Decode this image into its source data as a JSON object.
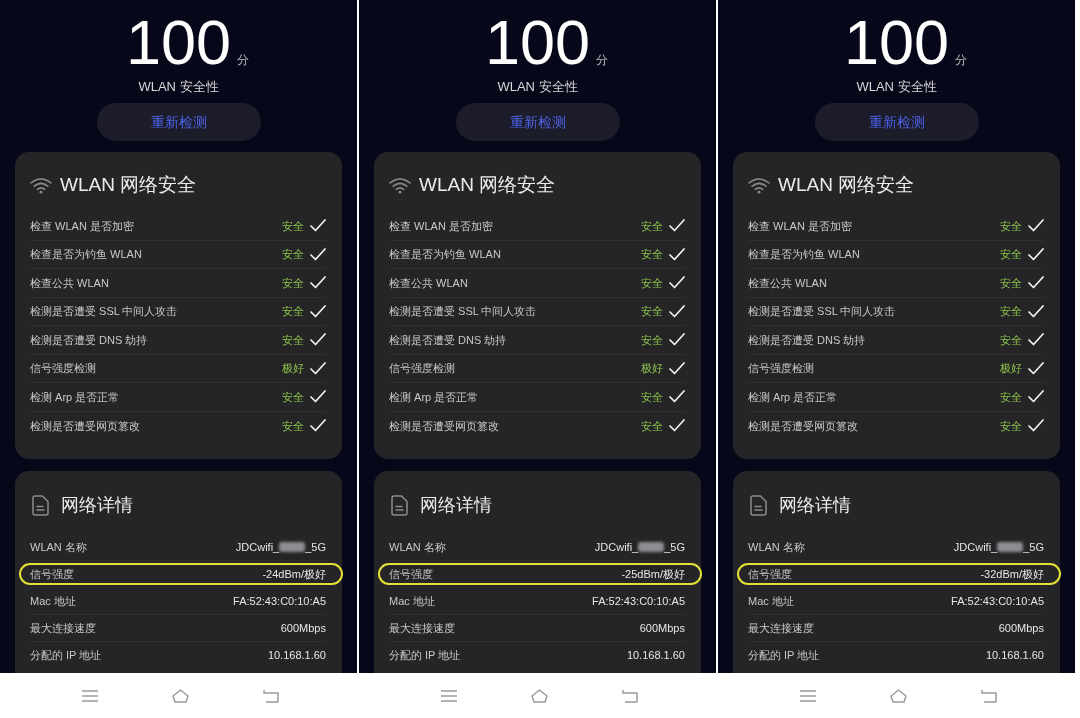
{
  "screens": [
    {
      "score": "100",
      "score_unit": "分",
      "score_label": "WLAN 安全性",
      "rescan_button": "重新检测",
      "security_card": {
        "title": "WLAN 网络安全",
        "checks": [
          {
            "label": "检查 WLAN 是否加密",
            "result": "安全",
            "passed": true
          },
          {
            "label": "检查是否为钓鱼 WLAN",
            "result": "安全",
            "passed": true
          },
          {
            "label": "检查公共 WLAN",
            "result": "安全",
            "passed": true
          },
          {
            "label": "检测是否遭受 SSL 中间人攻击",
            "result": "安全",
            "passed": true
          },
          {
            "label": "检测是否遭受 DNS 劫持",
            "result": "安全",
            "passed": true
          },
          {
            "label": "信号强度检测",
            "result": "极好",
            "passed": true
          },
          {
            "label": "检测 Arp 是否正常",
            "result": "安全",
            "passed": true
          },
          {
            "label": "检测是否遭受网页篡改",
            "result": "安全",
            "passed": true
          }
        ]
      },
      "details_card": {
        "title": "网络详情",
        "rows": [
          {
            "label": "WLAN 名称",
            "value": "JDCwifi_",
            "redacted": true,
            "value_end": "_5G",
            "highlighted": false
          },
          {
            "label": "信号强度",
            "value": "-24dBm/极好",
            "redacted": false,
            "highlighted": true
          },
          {
            "label": "Mac 地址",
            "value": "FA:52:43:C0:10:A5",
            "redacted": false,
            "highlighted": false
          },
          {
            "label": "最大连接速度",
            "value": "600Mbps",
            "redacted": false,
            "highlighted": false
          },
          {
            "label": "分配的 IP 地址",
            "value": "10.168.1.60",
            "redacted": false,
            "highlighted": false
          }
        ]
      }
    },
    {
      "score": "100",
      "score_unit": "分",
      "score_label": "WLAN 安全性",
      "rescan_button": "重新检测",
      "security_card": {
        "title": "WLAN 网络安全",
        "checks": [
          {
            "label": "检查 WLAN 是否加密",
            "result": "安全",
            "passed": true
          },
          {
            "label": "检查是否为钓鱼 WLAN",
            "result": "安全",
            "passed": true
          },
          {
            "label": "检查公共 WLAN",
            "result": "安全",
            "passed": true
          },
          {
            "label": "检测是否遭受 SSL 中间人攻击",
            "result": "安全",
            "passed": true
          },
          {
            "label": "检测是否遭受 DNS 劫持",
            "result": "安全",
            "passed": true
          },
          {
            "label": "信号强度检测",
            "result": "极好",
            "passed": true
          },
          {
            "label": "检测 Arp 是否正常",
            "result": "安全",
            "passed": true
          },
          {
            "label": "检测是否遭受网页篡改",
            "result": "安全",
            "passed": true
          }
        ]
      },
      "details_card": {
        "title": "网络详情",
        "rows": [
          {
            "label": "WLAN 名称",
            "value": "JDCwifi_",
            "redacted": true,
            "value_end": "_5G",
            "highlighted": false
          },
          {
            "label": "信号强度",
            "value": "-25dBm/极好",
            "redacted": false,
            "highlighted": true
          },
          {
            "label": "Mac 地址",
            "value": "FA:52:43:C0:10:A5",
            "redacted": false,
            "highlighted": false
          },
          {
            "label": "最大连接速度",
            "value": "600Mbps",
            "redacted": false,
            "highlighted": false
          },
          {
            "label": "分配的 IP 地址",
            "value": "10.168.1.60",
            "redacted": false,
            "highlighted": false
          }
        ]
      }
    },
    {
      "score": "100",
      "score_unit": "分",
      "score_label": "WLAN 安全性",
      "rescan_button": "重新检测",
      "security_card": {
        "title": "WLAN 网络安全",
        "checks": [
          {
            "label": "检查 WLAN 是否加密",
            "result": "安全",
            "passed": true
          },
          {
            "label": "检查是否为钓鱼 WLAN",
            "result": "安全",
            "passed": true
          },
          {
            "label": "检查公共 WLAN",
            "result": "安全",
            "passed": true
          },
          {
            "label": "检测是否遭受 SSL 中间人攻击",
            "result": "安全",
            "passed": true
          },
          {
            "label": "检测是否遭受 DNS 劫持",
            "result": "安全",
            "passed": true
          },
          {
            "label": "信号强度检测",
            "result": "极好",
            "passed": true
          },
          {
            "label": "检测 Arp 是否正常",
            "result": "安全",
            "passed": true
          },
          {
            "label": "检测是否遭受网页篡改",
            "result": "安全",
            "passed": true
          }
        ]
      },
      "details_card": {
        "title": "网络详情",
        "rows": [
          {
            "label": "WLAN 名称",
            "value": "JDCwifi_",
            "redacted": true,
            "value_end": "_5G",
            "highlighted": false
          },
          {
            "label": "信号强度",
            "value": "-32dBm/极好",
            "redacted": false,
            "highlighted": true
          },
          {
            "label": "Mac 地址",
            "value": "FA:52:43:C0:10:A5",
            "redacted": false,
            "highlighted": false
          },
          {
            "label": "最大连接速度",
            "value": "600Mbps",
            "redacted": false,
            "highlighted": false
          },
          {
            "label": "分配的 IP 地址",
            "value": "10.168.1.60",
            "redacted": false,
            "highlighted": false
          }
        ]
      }
    }
  ]
}
